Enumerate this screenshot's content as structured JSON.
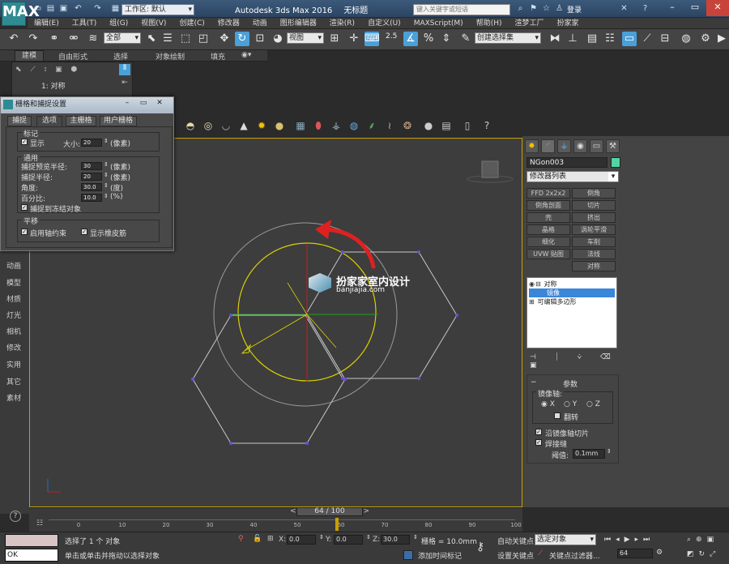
{
  "app": {
    "title": "Autodesk 3ds Max 2016",
    "doc": "无标题",
    "logo": "MAX",
    "workspace": "工作区: 默认",
    "search_placeholder": "键入关键字或短语",
    "login": "登录"
  },
  "menu": [
    "编辑(E)",
    "工具(T)",
    "组(G)",
    "视图(V)",
    "创建(C)",
    "修改器",
    "动画",
    "图形编辑器",
    "渲染(R)",
    "自定义(U)",
    "MAXScript(M)",
    "帮助(H)",
    "渲梦工厂",
    "扮家家"
  ],
  "toolbar": {
    "select_filter": "全部",
    "ref_coord": "视图",
    "snap_value": "2.5",
    "selection_set": "创建选择集"
  },
  "ribbon": {
    "tabs": [
      "建模",
      "自由形式",
      "选择",
      "对象绘制",
      "填充"
    ],
    "panel_label": "1: 对称"
  },
  "left_tabs": [
    "动画",
    "模型",
    "材质",
    "灯光",
    "相机",
    "修改",
    "实用",
    "其它",
    "素材"
  ],
  "dialog": {
    "title": "栅格和捕捉设置",
    "tabs": [
      "捕捉",
      "选项",
      "主栅格",
      "用户栅格"
    ],
    "marker": {
      "title": "标记",
      "display": "显示",
      "size_label": "大小:",
      "size": "20",
      "unit": "(像素)"
    },
    "general": {
      "title": "通用",
      "preview_radius_label": "捕捉预览半径:",
      "preview_radius": "30",
      "snap_radius_label": "捕捉半径:",
      "snap_radius": "20",
      "angle_label": "角度:",
      "angle": "30.0",
      "angle_unit": "(度)",
      "percent_label": "百分比:",
      "percent": "10.0",
      "percent_unit": "(%)",
      "frozen": "捕捉到冻结对象",
      "unit": "(像素)"
    },
    "translation": {
      "title": "平移",
      "axis_constraints": "启用轴约束",
      "rubber_band": "显示橡皮筋"
    }
  },
  "watermark": {
    "cn": "扮家家室内设计",
    "url": "banjiajia.com"
  },
  "command_panel": {
    "object_name": "NGon003",
    "modifier_list": "修改器列表",
    "buttons": [
      "FFD 2x2x2",
      "倒角",
      "倒角剖面",
      "切片",
      "壳",
      "挤出",
      "晶格",
      "涡轮平滑",
      "细化",
      "车削",
      "UVW 贴图",
      "法线",
      "",
      "对称"
    ],
    "stack": [
      {
        "label": "对称",
        "level": 0,
        "selected": false
      },
      {
        "label": "镜像",
        "level": 1,
        "selected": true
      },
      {
        "label": "可编辑多边形",
        "level": 0,
        "selected": false
      }
    ],
    "params": {
      "title": "参数",
      "mirror_axis": "镜像轴:",
      "axes": [
        "X",
        "Y",
        "Z"
      ],
      "flip": "翻转",
      "slice": "沿镜像轴切片",
      "weld": "焊接缝",
      "threshold_label": "阈值:",
      "threshold": "0.1mm"
    }
  },
  "timeline": {
    "position": "64 / 100",
    "ticks": [
      "0",
      "10",
      "20",
      "30",
      "40",
      "50",
      "60",
      "70",
      "80",
      "90",
      "100"
    ]
  },
  "status": {
    "left_field": "OK",
    "selected": "选择了 1 个 对象",
    "hint": "单击或单击并拖动以选择对象",
    "x_label": "X:",
    "x": "0.0",
    "y_label": "Y:",
    "y": "0.0",
    "z_label": "Z:",
    "z": "30.0",
    "grid": "栅格 = 10.0mm",
    "add_time_tag": "添加时间标记",
    "auto_key": "自动关键点",
    "set_key": "设置关键点",
    "selected_obj": "选定对象",
    "key_filter": "关键点过滤器...",
    "frame": "64"
  }
}
